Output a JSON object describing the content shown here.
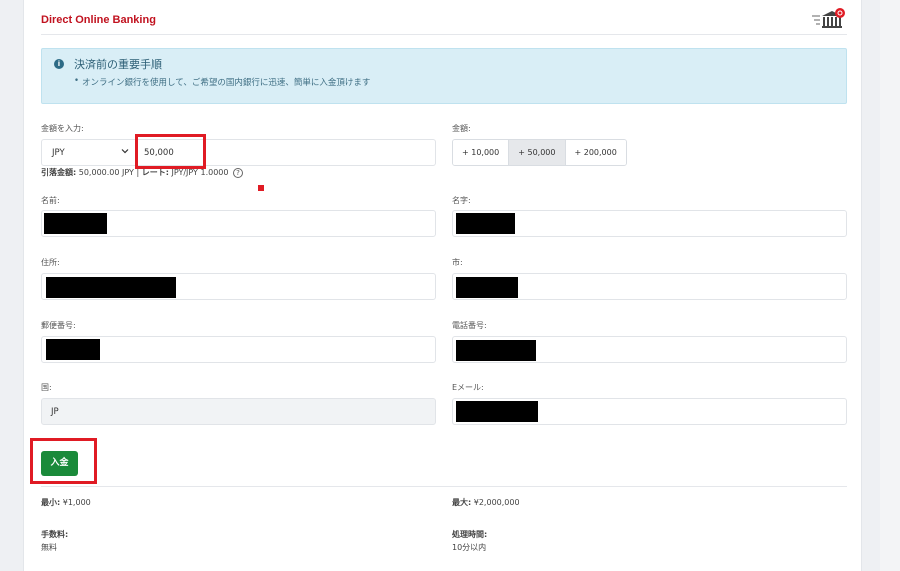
{
  "header": {
    "title": "Direct Online Banking",
    "bank_icon": "bank-icon"
  },
  "notice": {
    "icon": "info-icon",
    "icon_glyph": "i",
    "title": "決済前の重要手順",
    "item": "オンライン銀行を使用して、ご希望の国内銀行に迅速、簡単に入金頂けます"
  },
  "amount": {
    "label": "金額を入力:",
    "currency": "JPY",
    "value": "50,000",
    "summary_label": "引落金額:",
    "summary_value": "50,000.00 JPY",
    "separator": "|",
    "rate_label": "レート:",
    "rate_value": "JPY/JPY 1.0000",
    "help_glyph": "?"
  },
  "quick_amount": {
    "label": "金額:",
    "options": [
      "+ 10,000",
      "+ 50,000",
      "+ 200,000"
    ]
  },
  "fields": {
    "first_name_label": "名前:",
    "last_name_label": "名字:",
    "address_label": "住所:",
    "city_label": "市:",
    "postal_label": "郵便番号:",
    "phone_label": "電話番号:",
    "country_label": "国:",
    "country_value": "JP",
    "email_label": "Eメール:"
  },
  "submit": {
    "label": "入金"
  },
  "limits": {
    "min_label": "最小:",
    "min_value": "¥1,000",
    "max_label": "最大:",
    "max_value": "¥2,000,000",
    "fee_label": "手数料:",
    "fee_value": "無料",
    "time_label": "処理時間:",
    "time_value": "10分以内"
  },
  "colors": {
    "brand_red": "#c1121f",
    "highlight_red": "#e01b24",
    "submit_green": "#1a8a3a",
    "notice_bg": "#d9eef6"
  }
}
